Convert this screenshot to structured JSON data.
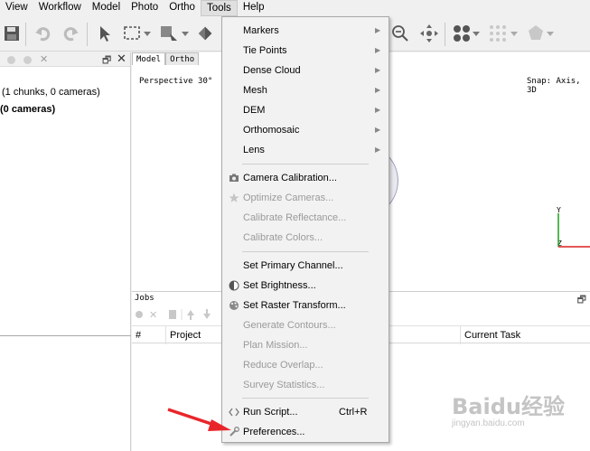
{
  "menubar": {
    "items": [
      {
        "label": "View"
      },
      {
        "label": "Workflow"
      },
      {
        "label": "Model"
      },
      {
        "label": "Photo"
      },
      {
        "label": "Ortho"
      },
      {
        "label": "Tools"
      },
      {
        "label": "Help"
      }
    ]
  },
  "workspace": {
    "line1": "(1 chunks, 0 cameras)",
    "line2": "(0 cameras)"
  },
  "view": {
    "tabs": [
      "Model",
      "Ortho"
    ],
    "perspective": "Perspective 30°",
    "snap": "Snap: Axis, 3D",
    "axis_y": "Y",
    "axis_z": "Z"
  },
  "jobs": {
    "title": "Jobs",
    "columns": [
      "#",
      "Project",
      "Current Task"
    ]
  },
  "tools_menu": {
    "submenus": [
      "Markers",
      "Tie Points",
      "Dense Cloud",
      "Mesh",
      "DEM",
      "Orthomosaic",
      "Lens"
    ],
    "camera_calibration": "Camera Calibration...",
    "optimize_cameras": "Optimize Cameras...",
    "calibrate_reflectance": "Calibrate Reflectance...",
    "calibrate_colors": "Calibrate Colors...",
    "set_primary_channel": "Set Primary Channel...",
    "set_brightness": "Set Brightness...",
    "set_raster_transform": "Set Raster Transform...",
    "generate_contours": "Generate Contours...",
    "plan_mission": "Plan Mission...",
    "reduce_overlap": "Reduce Overlap...",
    "survey_statistics": "Survey Statistics...",
    "run_script": "Run Script...",
    "run_script_shortcut": "Ctrl+R",
    "preferences": "Preferences..."
  },
  "watermark": {
    "brand": "Baidu经验",
    "url": "jingyan.baidu.com"
  },
  "colors": {
    "annotation_arrow": "#e8262a",
    "axis_y": "#1aa01a",
    "axis_z": "#d92020"
  }
}
